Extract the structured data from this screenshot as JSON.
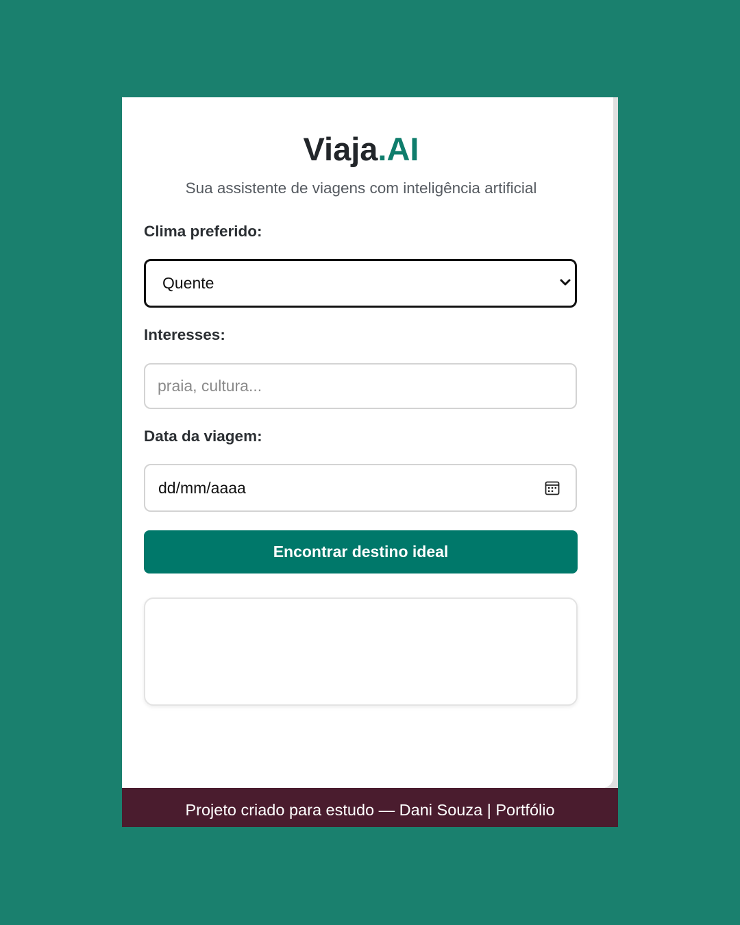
{
  "app": {
    "title_main": "Viaja",
    "title_accent": ".AI",
    "subtitle": "Sua assistente de viagens com inteligência artificial"
  },
  "form": {
    "climate_label": "Clima preferido:",
    "climate_value": "Quente",
    "interests_label": "Interesses:",
    "interests_placeholder": "praia, cultura...",
    "interests_value": "",
    "date_label": "Data da viagem:",
    "date_placeholder": "dd/mm/aaaa",
    "submit_label": "Encontrar destino ideal"
  },
  "result": {
    "content": ""
  },
  "footer": {
    "text": "Projeto criado para estudo — Dani Souza",
    "separator": "|",
    "portfolio_link": "Portfólio"
  },
  "icons": {
    "select_arrow": "chevron-down-icon",
    "date_picker": "calendar-icon"
  },
  "colors": {
    "background": "#1a806e",
    "accent": "#0f7d6c",
    "button": "#00786a",
    "footer": "#4a1c2e",
    "card": "#ffffff"
  }
}
